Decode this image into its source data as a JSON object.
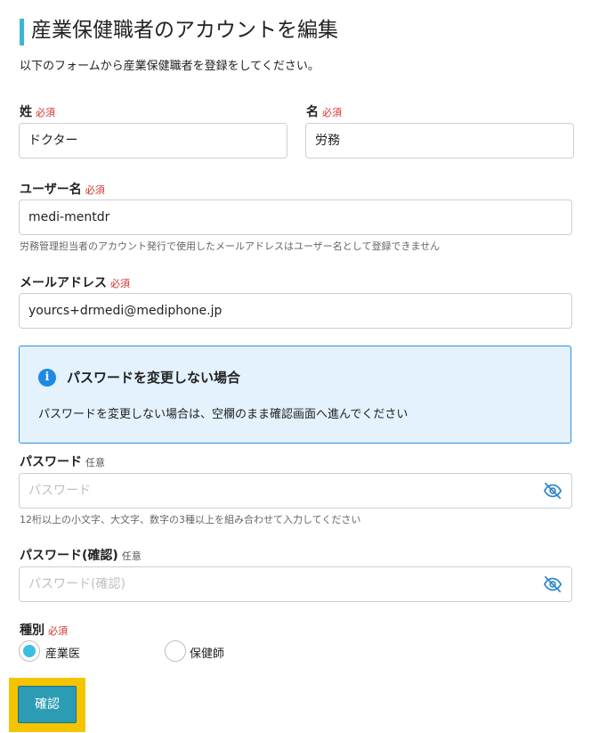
{
  "header": {
    "title": "産業保健職者のアカウントを編集",
    "subtitle": "以下のフォームから産業保健職者を登録をしてください。"
  },
  "fields": {
    "last_name": {
      "label": "姓",
      "badge": "必須",
      "value": "ドクター"
    },
    "first_name": {
      "label": "名",
      "badge": "必須",
      "value": "労務"
    },
    "username": {
      "label": "ユーザー名",
      "badge": "必須",
      "value": "medi-mentdr",
      "help": "労務管理担当者のアカウント発行で使用したメールアドレスはユーザー名として登録できません"
    },
    "email": {
      "label": "メールアドレス",
      "badge": "必須",
      "value": "yourcs+drmedi@mediphone.jp"
    },
    "password": {
      "label": "パスワード",
      "badge": "任意",
      "placeholder": "パスワード",
      "help": "12桁以上の小文字、大文字、数字の3種以上を組み合わせて入力してください"
    },
    "password_confirm": {
      "label": "パスワード(確認)",
      "badge": "任意",
      "placeholder": "パスワード(確認)"
    },
    "type": {
      "label": "種別",
      "badge": "必須",
      "options": [
        {
          "label": "産業医",
          "selected": true
        },
        {
          "label": "保健師",
          "selected": false
        }
      ]
    }
  },
  "info": {
    "icon": "info-icon",
    "title": "パスワードを変更しない場合",
    "text": "パスワードを変更しない場合は、空欄のまま確認画面へ進んでください"
  },
  "submit": {
    "label": "確認"
  },
  "colors": {
    "accent": "#3bb4d6",
    "required": "#d0302a",
    "info_bg": "#e3f2fd",
    "info_border": "#2f8ed8",
    "button": "#2b9cb3",
    "highlight": "#f5c400"
  }
}
